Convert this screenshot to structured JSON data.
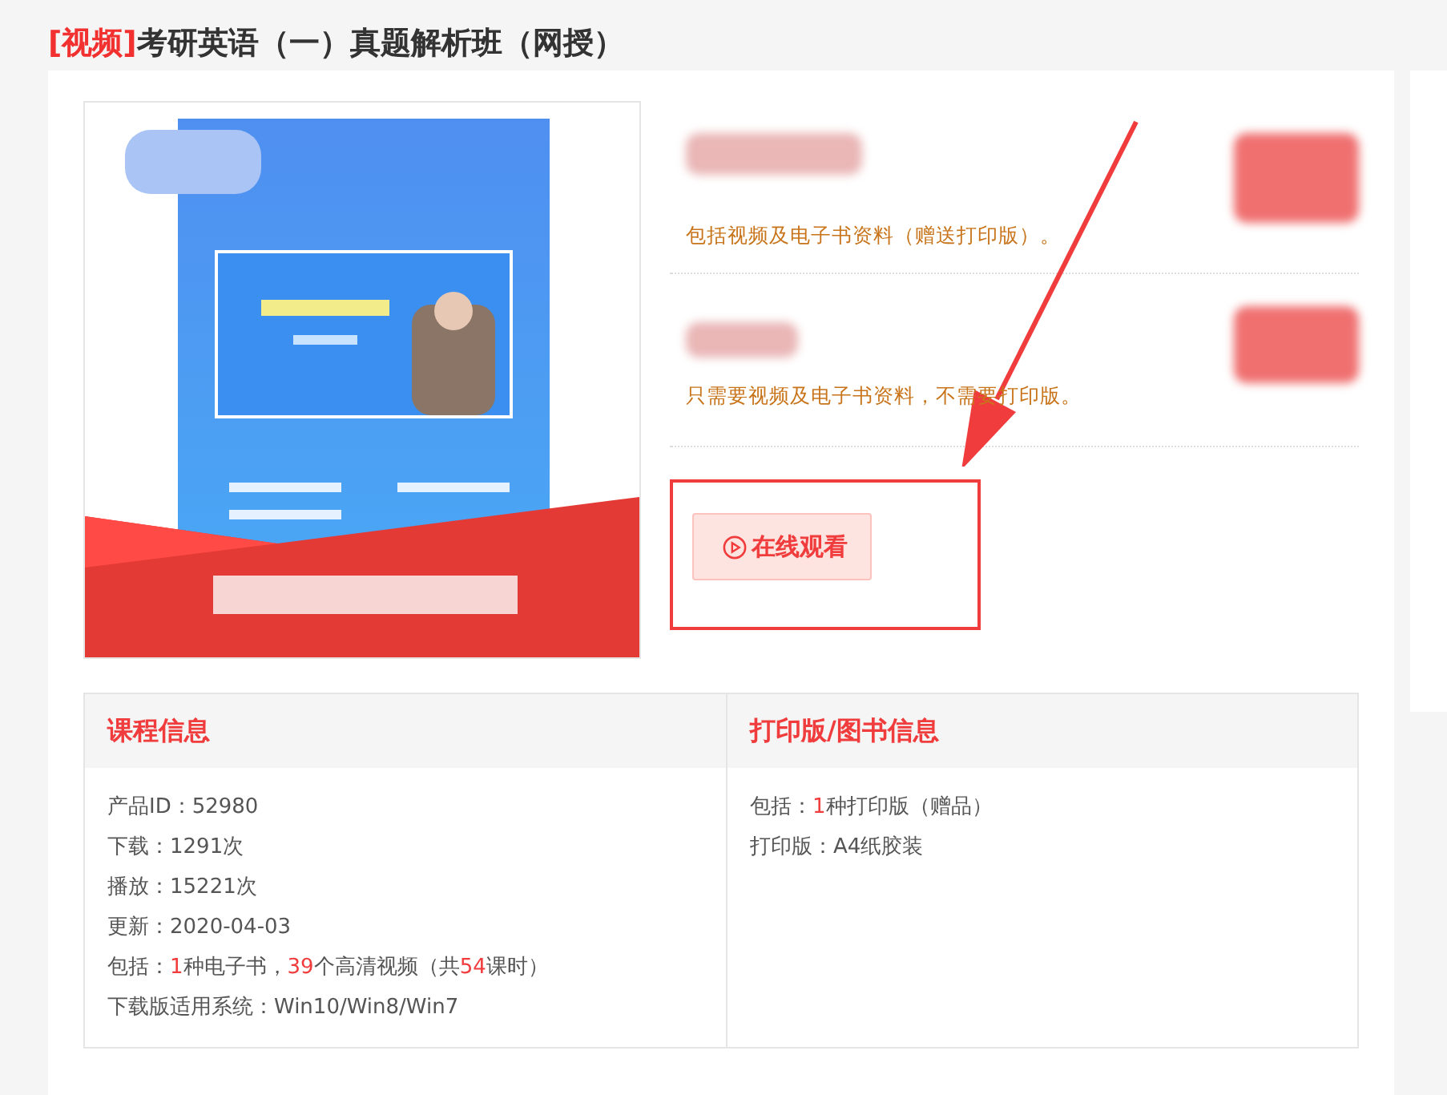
{
  "title": {
    "tag": "[视频]",
    "text": "考研英语（一）真题解析班（网授）"
  },
  "options": [
    {
      "description": "包括视频及电子书资料（赠送打印版）。"
    },
    {
      "description": "只需要视频及电子书资料，不需要打印版。"
    }
  ],
  "watch_button": {
    "label": "在线观看"
  },
  "info": [
    {
      "heading": "课程信息",
      "lines": [
        [
          {
            "text": "产品ID：52980",
            "hot": false
          }
        ],
        [
          {
            "text": "下载：1291次",
            "hot": false
          }
        ],
        [
          {
            "text": "播放：15221次",
            "hot": false
          }
        ],
        [
          {
            "text": "更新：2020-04-03",
            "hot": false
          }
        ],
        [
          {
            "text": "包括：",
            "hot": false
          },
          {
            "text": "1",
            "hot": true
          },
          {
            "text": "种电子书，",
            "hot": false
          },
          {
            "text": "39",
            "hot": true
          },
          {
            "text": "个高清视频（共",
            "hot": false
          },
          {
            "text": "54",
            "hot": true
          },
          {
            "text": "课时）",
            "hot": false
          }
        ],
        [
          {
            "text": "下载版适用系统：Win10/Win8/Win7",
            "hot": false
          }
        ]
      ]
    },
    {
      "heading": "打印版/图书信息",
      "lines": [
        [
          {
            "text": "包括：",
            "hot": false
          },
          {
            "text": "1",
            "hot": true
          },
          {
            "text": "种打印版（赠品）",
            "hot": false
          }
        ],
        [
          {
            "text": "打印版：A4纸胶装",
            "hot": false
          }
        ]
      ]
    }
  ]
}
